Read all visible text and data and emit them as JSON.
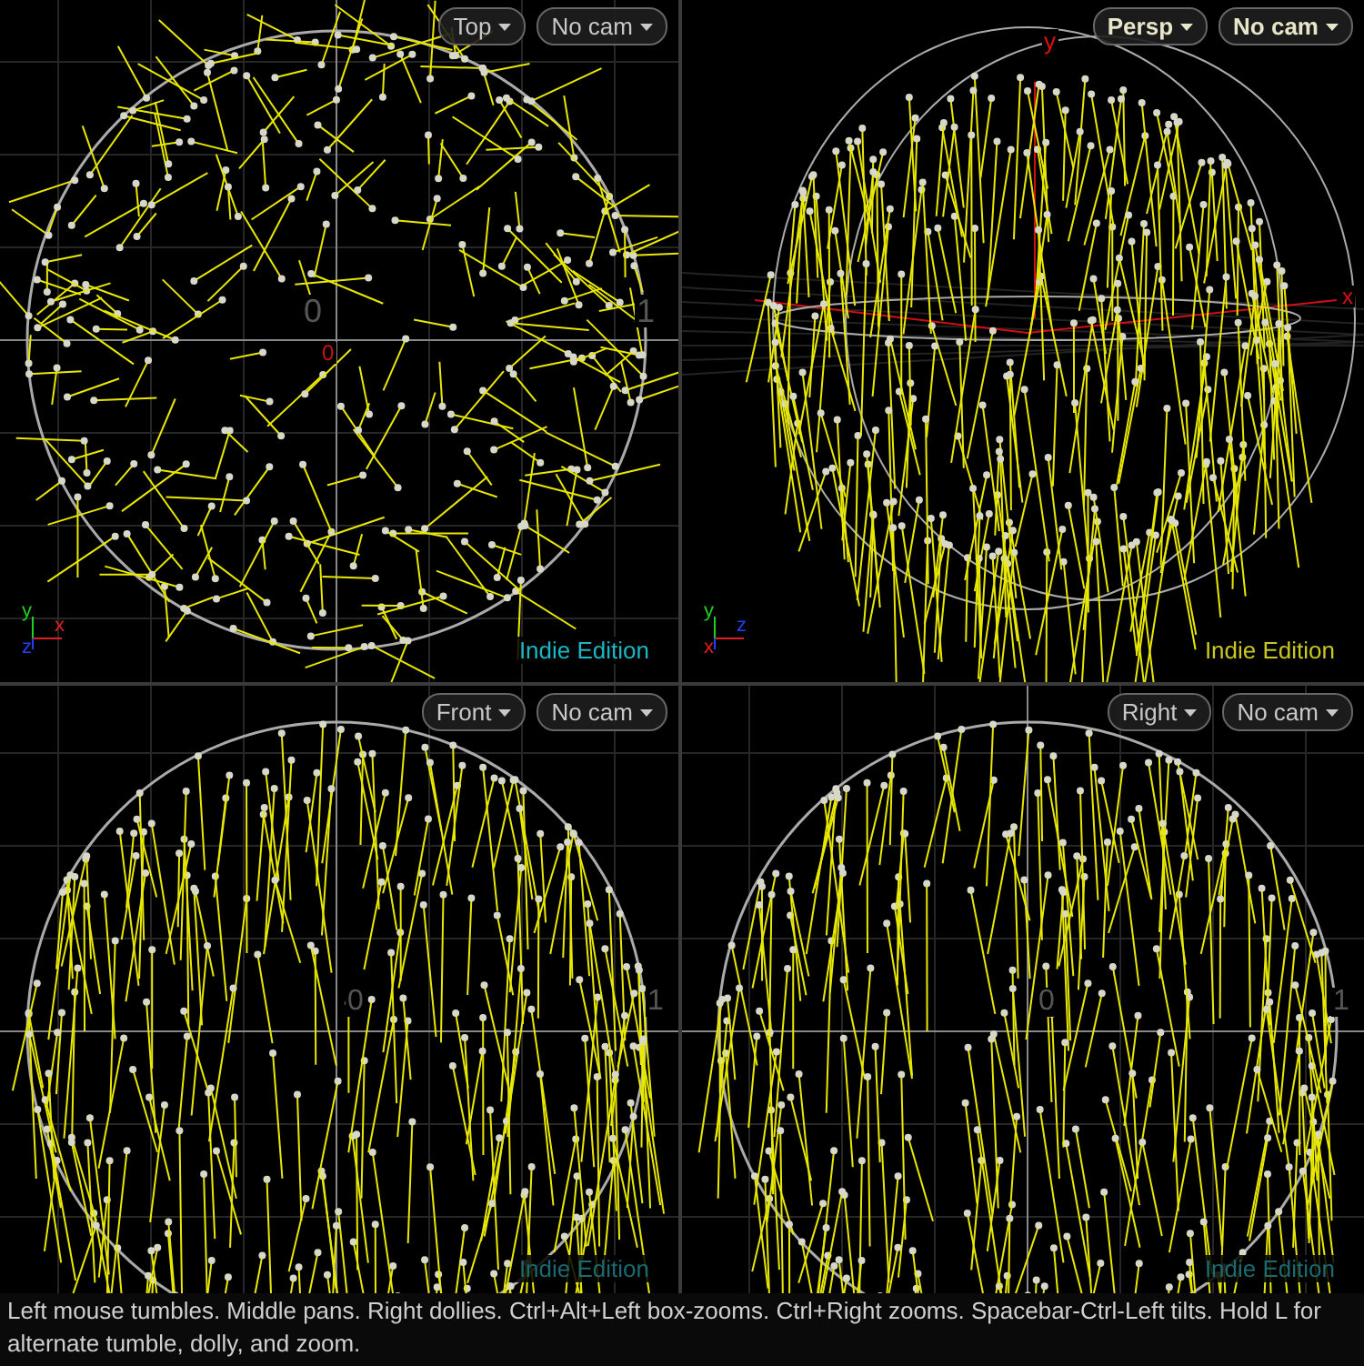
{
  "viewports": [
    {
      "kind": "top",
      "selected": false,
      "view_label": "Top",
      "camera_label": "No cam",
      "watermark": {
        "text": "Indie Edition",
        "color": "#1ab8c4"
      },
      "gizmo": [
        {
          "label": "y",
          "color": "#20d020"
        },
        {
          "label": "x",
          "color": "#e02020"
        },
        {
          "label": "z",
          "color": "#2040ff"
        }
      ],
      "axis_labels": [
        "0",
        "1",
        "0"
      ]
    },
    {
      "kind": "persp",
      "selected": true,
      "view_label": "Persp",
      "camera_label": "No cam",
      "watermark": {
        "text": "Indie Edition",
        "color": "#c8c81e"
      },
      "gizmo": [
        {
          "label": "y",
          "color": "#20d020"
        },
        {
          "label": "z",
          "color": "#2040ff"
        },
        {
          "label": "x",
          "color": "#e02020"
        }
      ],
      "axis_labels": [
        "y",
        "x"
      ]
    },
    {
      "kind": "front",
      "selected": false,
      "view_label": "Front",
      "camera_label": "No cam",
      "watermark": {
        "text": "Indie Edition",
        "color": "#1a6a70"
      },
      "axis_labels": [
        "0",
        "1"
      ]
    },
    {
      "kind": "right",
      "selected": false,
      "view_label": "Right",
      "camera_label": "No cam",
      "watermark": {
        "text": "Indie Edition",
        "color": "#1a6a70"
      },
      "axis_labels": [
        "0",
        "1"
      ]
    }
  ],
  "hint": "Left mouse tumbles. Middle pans. Right dollies. Ctrl+Alt+Left box-zooms. Ctrl+Right zooms. Spacebar-Ctrl-Left tilts. Hold L for alternate tumble, dolly, and zoom."
}
